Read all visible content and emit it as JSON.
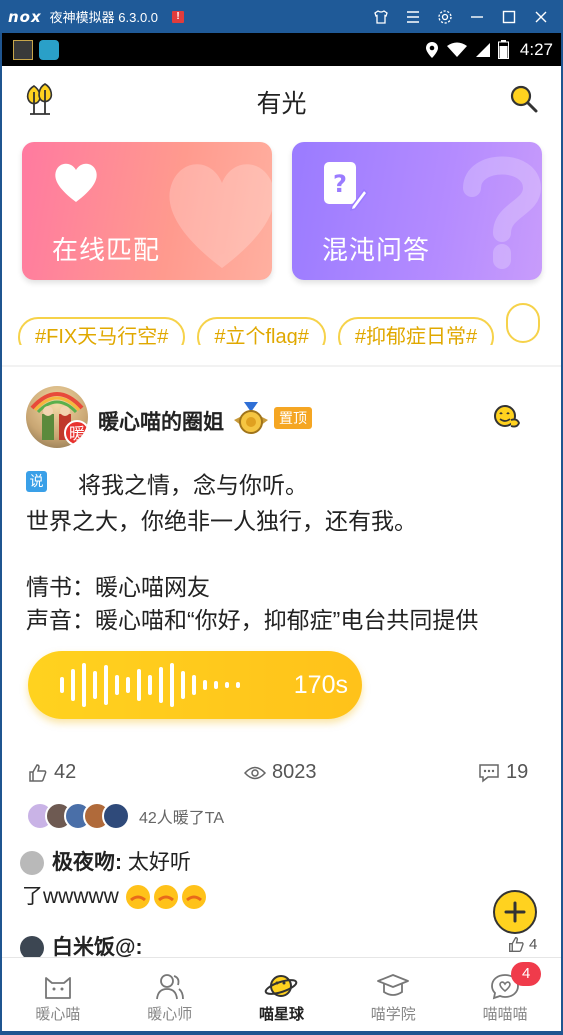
{
  "emulator": {
    "logo": "nox",
    "title": "夜神模拟器 6.3.0.0",
    "warning": "!",
    "controls": [
      "tshirt-icon",
      "menu-icon",
      "gear-icon",
      "minimize-icon",
      "maximize-icon",
      "close-icon"
    ]
  },
  "status_bar": {
    "time": "4:27"
  },
  "header": {
    "title": "有光"
  },
  "cards": [
    {
      "label": "在线匹配",
      "color": "#ff8aa0"
    },
    {
      "label": "混沌问答",
      "color": "#a786ff"
    }
  ],
  "tags": [
    "#FIX天马行空#",
    "#立个flag#",
    "#抑郁症日常#"
  ],
  "post": {
    "avatar_badge": "暖",
    "username": "暖心喵的圈姐",
    "pinned": "置顶",
    "say_label": "说",
    "lines": [
      "将我之情，念与你听。",
      "世界之大，你绝非一人独行，还有我。",
      "",
      "情书：暖心喵网友",
      "声音：暖心喵和“你好，抑郁症”电台共同提供"
    ],
    "audio_duration": "170s",
    "likes": "42",
    "views": "8023",
    "comments": "19",
    "warmed_text": "42人暖了TA"
  },
  "comments": [
    {
      "user": "极夜吻",
      "sep": ":",
      "text": " 太好听",
      "text2": "了wwwww"
    },
    {
      "user": "白米饭@",
      "sep": ":",
      "likes": "4"
    }
  ],
  "bottom_nav": [
    {
      "label": "暖心喵",
      "icon": "cat-icon"
    },
    {
      "label": "暖心师",
      "icon": "people-icon"
    },
    {
      "label": "喵星球",
      "icon": "planet-icon",
      "active": true
    },
    {
      "label": "喵学院",
      "icon": "graduation-cap-icon"
    },
    {
      "label": "喵喵喵",
      "icon": "heart-chat-icon",
      "badge": "4"
    }
  ],
  "colors": {
    "accent": "#ffd21f",
    "tag": "#e0a800",
    "badge": "#f03b4b"
  }
}
